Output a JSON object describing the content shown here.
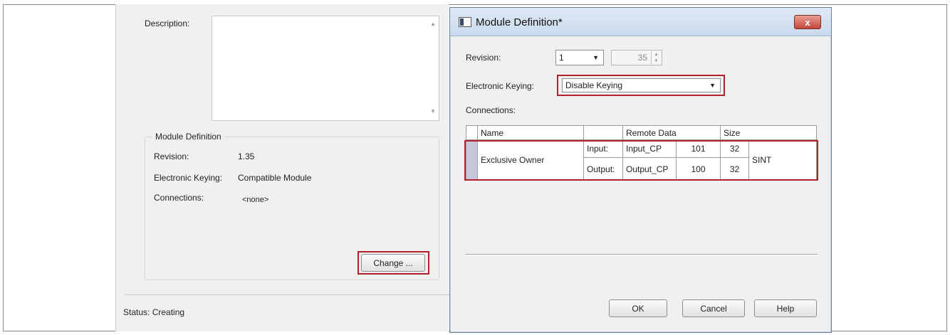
{
  "background_window": {
    "description_label": "Description:",
    "module_definition": {
      "group_title": "Module Definition",
      "revision_label": "Revision:",
      "revision_value": "1.35",
      "keying_label": "Electronic Keying:",
      "keying_value": "Compatible Module",
      "connections_label": "Connections:",
      "connections_value": "<none>"
    },
    "change_button": "Change ...",
    "status_text": "Status:  Creating"
  },
  "dialog": {
    "title": "Module Definition*",
    "close_glyph": "x",
    "revision_label": "Revision:",
    "revision_major": "1",
    "revision_minor": "35",
    "keying_label": "Electronic Keying:",
    "keying_value": "Disable Keying",
    "connections_label": "Connections:",
    "table": {
      "headers": {
        "name": "Name",
        "remote_data": "Remote Data",
        "size": "Size"
      },
      "connection_name": "Exclusive Owner",
      "rows": [
        {
          "direction": "Input:",
          "tag": "Input_CP",
          "instance": "101",
          "size": "32"
        },
        {
          "direction": "Output:",
          "tag": "Output_CP",
          "instance": "100",
          "size": "32"
        }
      ],
      "data_type": "SINT"
    },
    "buttons": {
      "ok": "OK",
      "cancel": "Cancel",
      "help": "Help"
    }
  },
  "colors": {
    "highlight_red": "#b4212b",
    "dialog_background": "#f0f0f0",
    "close_button": "#c6463a"
  }
}
